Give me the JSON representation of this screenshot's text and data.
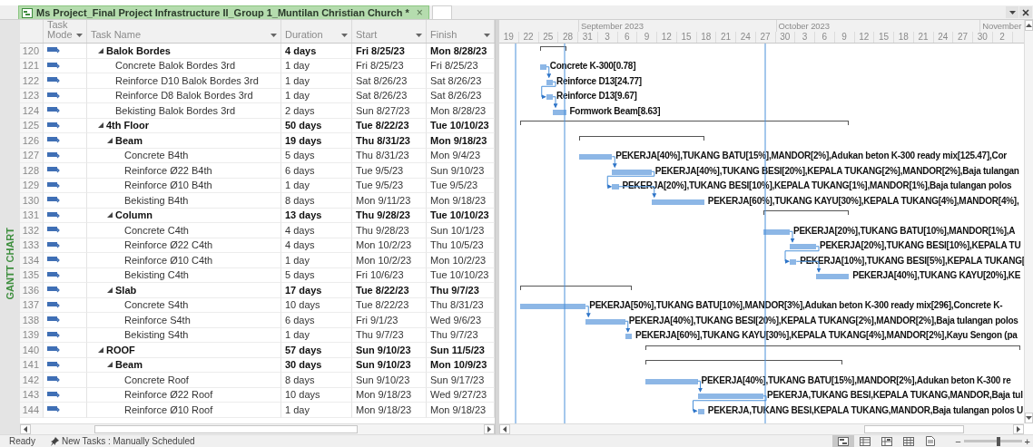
{
  "document_tab": {
    "title": "Ms Project_Final Project Infrastructure II_Group 1_Muntilan Christian Church *",
    "close": "×"
  },
  "view_bar": {
    "label": "GANTT CHART"
  },
  "columns": [
    {
      "label": "Task Mode"
    },
    {
      "label": "Task Name"
    },
    {
      "label": "Duration"
    },
    {
      "label": "Start"
    },
    {
      "label": "Finish"
    }
  ],
  "timescale": {
    "months": [
      "September 2023",
      "October 2023",
      "November"
    ],
    "days": [
      "19",
      "22",
      "25",
      "28",
      "31",
      "3",
      "6",
      "9",
      "12",
      "15",
      "18",
      "21",
      "24",
      "27",
      "30",
      "3",
      "6",
      "9",
      "12",
      "15",
      "18",
      "21",
      "24",
      "27",
      "30",
      "2"
    ]
  },
  "tasks": [
    {
      "id": "120",
      "name": "Balok Bordes",
      "duration": "4 days",
      "start": "Fri 8/25/23",
      "finish": "Mon 8/28/23",
      "expanded": true,
      "children": [
        {
          "id": "121",
          "name": "Concrete Balok Bordes 3rd",
          "duration": "1 day",
          "start": "Fri 8/25/23",
          "finish": "Fri 8/25/23",
          "bar_label": "Concrete K-300[0.78]"
        },
        {
          "id": "122",
          "name": "Reinforce D10 Balok Bordes 3rd",
          "duration": "1 day",
          "start": "Sat 8/26/23",
          "finish": "Sat 8/26/23",
          "bar_label": "Reinforce D13[24.77]"
        },
        {
          "id": "123",
          "name": "Reinforce D8 Balok Bordes 3rd",
          "duration": "1 day",
          "start": "Sat 8/26/23",
          "finish": "Sat 8/26/23",
          "bar_label": "Reinforce D13[9.67]"
        },
        {
          "id": "124",
          "name": "Bekisting Balok Bordes 3rd",
          "duration": "2 days",
          "start": "Sun 8/27/23",
          "finish": "Mon 8/28/23",
          "bar_label": "Formwork Beam[8.63]"
        }
      ]
    },
    {
      "id": "125",
      "name": "4th Floor",
      "duration": "50 days",
      "start": "Tue 8/22/23",
      "finish": "Tue 10/10/23",
      "expanded": true,
      "children": [
        {
          "id": "126",
          "name": "Beam",
          "duration": "19 days",
          "start": "Thu 8/31/23",
          "finish": "Mon 9/18/23",
          "expanded": true,
          "children": [
            {
              "id": "127",
              "name": "Concrete B4th",
              "duration": "5 days",
              "start": "Thu 8/31/23",
              "finish": "Mon 9/4/23",
              "bar_label": "PEKERJA[40%],TUKANG BATU[15%],MANDOR[2%],Adukan beton K-300 ready mix[125.47],Cor"
            },
            {
              "id": "128",
              "name": "Reinforce Ø22 B4th",
              "duration": "6 days",
              "start": "Tue 9/5/23",
              "finish": "Sun 9/10/23",
              "bar_label": "PEKERJA[40%],TUKANG BESI[20%],KEPALA TUKANG[2%],MANDOR[2%],Baja tulangan"
            },
            {
              "id": "129",
              "name": "Reinforce Ø10 B4th",
              "duration": "1 day",
              "start": "Tue 9/5/23",
              "finish": "Tue 9/5/23",
              "bar_label": "PEKERJA[20%],TUKANG BESI[10%],KEPALA TUKANG[1%],MANDOR[1%],Baja tulangan polos"
            },
            {
              "id": "130",
              "name": "Bekisting B4th",
              "duration": "8 days",
              "start": "Mon 9/11/23",
              "finish": "Mon 9/18/23",
              "bar_label": "PEKERJA[60%],TUKANG KAYU[30%],KEPALA TUKANG[4%],MANDOR[4%],"
            }
          ]
        },
        {
          "id": "131",
          "name": "Column",
          "duration": "13 days",
          "start": "Thu 9/28/23",
          "finish": "Tue 10/10/23",
          "expanded": true,
          "children": [
            {
              "id": "132",
              "name": "Concrete C4th",
              "duration": "4 days",
              "start": "Thu 9/28/23",
              "finish": "Sun 10/1/23",
              "bar_label": "PEKERJA[20%],TUKANG BATU[10%],MANDOR[1%],A"
            },
            {
              "id": "133",
              "name": "Reinforce Ø22 C4th",
              "duration": "4 days",
              "start": "Mon 10/2/23",
              "finish": "Thu 10/5/23",
              "bar_label": "PEKERJA[20%],TUKANG BESI[10%],KEPALA TU"
            },
            {
              "id": "134",
              "name": "Reinforce Ø10 C4th",
              "duration": "1 day",
              "start": "Mon 10/2/23",
              "finish": "Mon 10/2/23",
              "bar_label": "PEKERJA[10%],TUKANG BESI[5%],KEPALA TUKANG["
            },
            {
              "id": "135",
              "name": "Bekisting C4th",
              "duration": "5 days",
              "start": "Fri 10/6/23",
              "finish": "Tue 10/10/23",
              "bar_label": "PEKERJA[40%],TUKANG KAYU[20%],KE"
            }
          ]
        },
        {
          "id": "136",
          "name": "Slab",
          "duration": "17 days",
          "start": "Tue 8/22/23",
          "finish": "Thu 9/7/23",
          "expanded": true,
          "children": [
            {
              "id": "137",
              "name": "Concrete S4th",
              "duration": "10 days",
              "start": "Tue 8/22/23",
              "finish": "Thu 8/31/23",
              "bar_label": "PEKERJA[50%],TUKANG BATU[10%],MANDOR[3%],Adukan beton K-300 ready mix[296],Concrete K-"
            },
            {
              "id": "138",
              "name": "Reinforce S4th",
              "duration": "6 days",
              "start": "Fri 9/1/23",
              "finish": "Wed 9/6/23",
              "bar_label": "PEKERJA[40%],TUKANG BESI[20%],KEPALA TUKANG[2%],MANDOR[2%],Baja tulangan polos"
            },
            {
              "id": "139",
              "name": "Bekisting S4th",
              "duration": "1 day",
              "start": "Thu 9/7/23",
              "finish": "Thu 9/7/23",
              "bar_label": "PEKERJA[60%],TUKANG KAYU[30%],KEPALA TUKANG[4%],MANDOR[2%],Kayu Sengon (pa"
            }
          ]
        }
      ]
    },
    {
      "id": "140",
      "name": "ROOF",
      "duration": "57 days",
      "start": "Sun 9/10/23",
      "finish": "Sun 11/5/23",
      "expanded": true,
      "children": [
        {
          "id": "141",
          "name": "Beam",
          "duration": "30 days",
          "start": "Sun 9/10/23",
          "finish": "Mon 10/9/23",
          "expanded": true,
          "children": [
            {
              "id": "142",
              "name": "Concrete Roof",
              "duration": "8 days",
              "start": "Sun 9/10/23",
              "finish": "Sun 9/17/23",
              "bar_label": "PEKERJA[40%],TUKANG BATU[15%],MANDOR[2%],Adukan beton K-300 re"
            },
            {
              "id": "143",
              "name": "Reinforce Ø22 Roof",
              "duration": "10 days",
              "start": "Mon 9/18/23",
              "finish": "Wed 9/27/23",
              "bar_label": "PEKERJA,TUKANG BESI,KEPALA TUKANG,MANDOR,Baja tul"
            },
            {
              "id": "144",
              "name": "Reinforce Ø10 Roof",
              "duration": "1 day",
              "start": "Mon 9/18/23",
              "finish": "Mon 9/18/23",
              "bar_label": "PEKERJA,TUKANG BESI,KEPALA TUKANG,MANDOR,Baja tulangan polos U"
            }
          ]
        }
      ]
    }
  ],
  "status_bar": {
    "ready": "Ready",
    "new_tasks": "New Tasks : Manually Scheduled",
    "views": [
      {
        "kind": "gantt",
        "selected": true
      },
      {
        "kind": "usage",
        "selected": false
      },
      {
        "kind": "team",
        "selected": false
      },
      {
        "kind": "sheet",
        "selected": false
      },
      {
        "kind": "report",
        "selected": false
      }
    ],
    "zoom_out": "−",
    "zoom_in": "+",
    "zoom": {
      "level": 0.6
    }
  }
}
